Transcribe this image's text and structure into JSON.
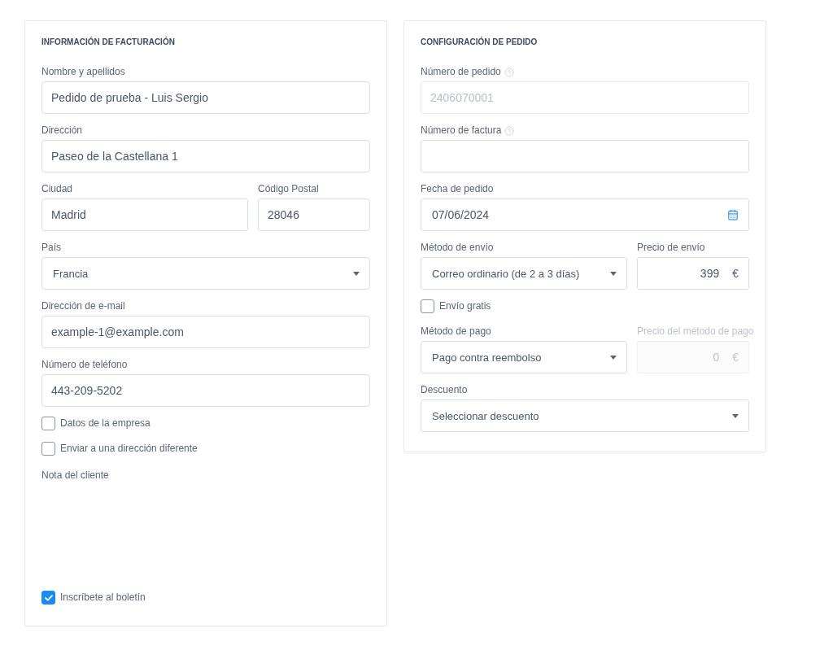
{
  "billing": {
    "title": "INFORMACIÓN DE FACTURACIÓN",
    "items": [
      {
        "kind": "fields",
        "fields": [
          {
            "kind": "text",
            "label": "Nombre y apellidos",
            "value": "Pedido de prueba - Luis Sergio",
            "disabled": false
          }
        ]
      },
      {
        "kind": "fields",
        "fields": [
          {
            "kind": "text",
            "label": "Dirección",
            "value": "Paseo de la Castellana 1",
            "disabled": false
          }
        ]
      },
      {
        "kind": "fields",
        "fields": [
          {
            "kind": "text",
            "label": "Ciudad",
            "value": "Madrid",
            "disabled": false
          },
          {
            "kind": "text",
            "label": "Código Postal",
            "value": "28046",
            "disabled": false
          }
        ]
      },
      {
        "kind": "fields",
        "fields": [
          {
            "kind": "select",
            "label": "País",
            "value": "Francia",
            "disabled": false
          }
        ]
      },
      {
        "kind": "fields",
        "fields": [
          {
            "kind": "text",
            "label": "Dirección de e-mail",
            "value": "example-1@example.com",
            "disabled": false
          }
        ]
      },
      {
        "kind": "fields",
        "fields": [
          {
            "kind": "text",
            "label": "Número de teléfono",
            "value": "443-209-5202",
            "disabled": false
          }
        ]
      },
      {
        "kind": "checkbox",
        "label": "Datos de la empresa",
        "checked": false
      },
      {
        "kind": "checkbox",
        "label": "Enviar a una dirección diferente",
        "checked": false
      },
      {
        "kind": "note",
        "label": "Nota del cliente"
      },
      {
        "kind": "checkbox",
        "label": "Inscríbete al boletín",
        "checked": true
      }
    ]
  },
  "order": {
    "title": "CONFIGURACIÓN DE PEDIDO",
    "items": [
      {
        "kind": "fields",
        "fields": [
          {
            "kind": "text",
            "label": "Número de pedido",
            "help": true,
            "placeholder": "2406070001"
          }
        ]
      },
      {
        "kind": "fields",
        "fields": [
          {
            "kind": "text",
            "label": "Número de factura",
            "help": true,
            "disabled": false
          }
        ]
      },
      {
        "kind": "fields",
        "fields": [
          {
            "kind": "date",
            "label": "Fecha de pedido",
            "value": "07/06/2024",
            "disabled": false
          }
        ]
      },
      {
        "kind": "fields",
        "fields": [
          {
            "kind": "select",
            "label": "Método de envío",
            "value": "Correo ordinario (de 2 a 3 días)",
            "disabled": false
          },
          {
            "kind": "price",
            "label": "Precio de envío",
            "value": "399",
            "suffix": "€",
            "disabled": false
          }
        ]
      },
      {
        "kind": "checkbox",
        "label": "Envío gratis",
        "checked": false
      },
      {
        "kind": "fields",
        "fields": [
          {
            "kind": "select",
            "label": "Método de pago",
            "value": "Pago contra reembolso",
            "disabled": false
          },
          {
            "kind": "price",
            "label": "Precio del método de pago",
            "value": "0",
            "suffix": "€",
            "disabled": true
          }
        ]
      },
      {
        "kind": "fields",
        "fields": [
          {
            "kind": "select",
            "label": "Descuento",
            "value": "Seleccionar descuento",
            "disabled": false
          }
        ]
      }
    ]
  }
}
